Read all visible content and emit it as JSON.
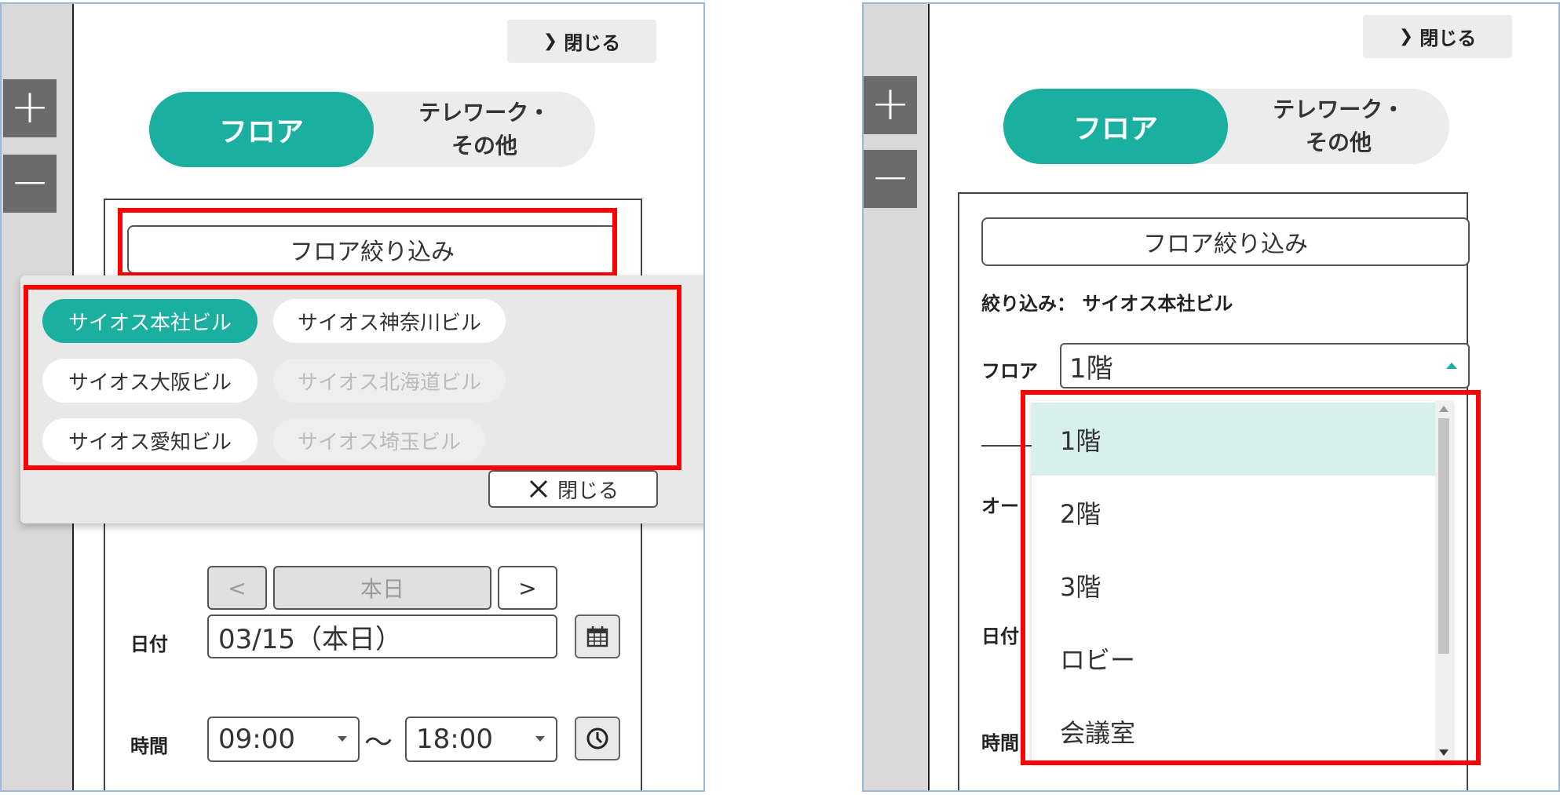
{
  "colors": {
    "accent": "#1aaf9f",
    "highlight": "#ff0000",
    "selected_option_bg": "#d8f0ec"
  },
  "icons": {
    "chevron": "chevron-right-icon",
    "close": "close-x-icon",
    "calendar": "calendar-icon",
    "clock": "clock-icon"
  },
  "left": {
    "zoom_in": "+",
    "zoom_out": "−",
    "close_label": "閉じる",
    "tabs": {
      "floor": "フロア",
      "telework_line1": "テレワーク・",
      "telework_line2": "その他"
    },
    "filter_button": "フロア絞り込み",
    "buildings": [
      {
        "label": "サイオス本社ビル",
        "state": "active"
      },
      {
        "label": "サイオス神奈川ビル",
        "state": "enabled"
      },
      {
        "label": "サイオス大阪ビル",
        "state": "enabled"
      },
      {
        "label": "サイオス北海道ビル",
        "state": "disabled"
      },
      {
        "label": "サイオス愛知ビル",
        "state": "enabled"
      },
      {
        "label": "サイオス埼玉ビル",
        "state": "disabled"
      }
    ],
    "popup_close": "閉じる",
    "prev": "<",
    "today": "本日",
    "next": ">",
    "date_label": "日付",
    "date_value": "03/15（本日）",
    "time_label": "時間",
    "time_start": "09:00",
    "time_sep": "〜",
    "time_end": "18:00"
  },
  "right": {
    "zoom_in": "+",
    "zoom_out": "−",
    "close_label": "閉じる",
    "tabs": {
      "floor": "フロア",
      "telework_line1": "テレワーク・",
      "telework_line2": "その他"
    },
    "filter_button": "フロア絞り込み",
    "filter_status": "絞り込み： サイオス本社ビル",
    "floor_label": "フロア",
    "floor_value": "1階",
    "floor_options": [
      "1階",
      "2階",
      "3階",
      "ロビー",
      "会議室"
    ],
    "selected_option": "1階",
    "partial_labels": {
      "owner": "オー",
      "date": "日付",
      "time": "時間"
    }
  }
}
